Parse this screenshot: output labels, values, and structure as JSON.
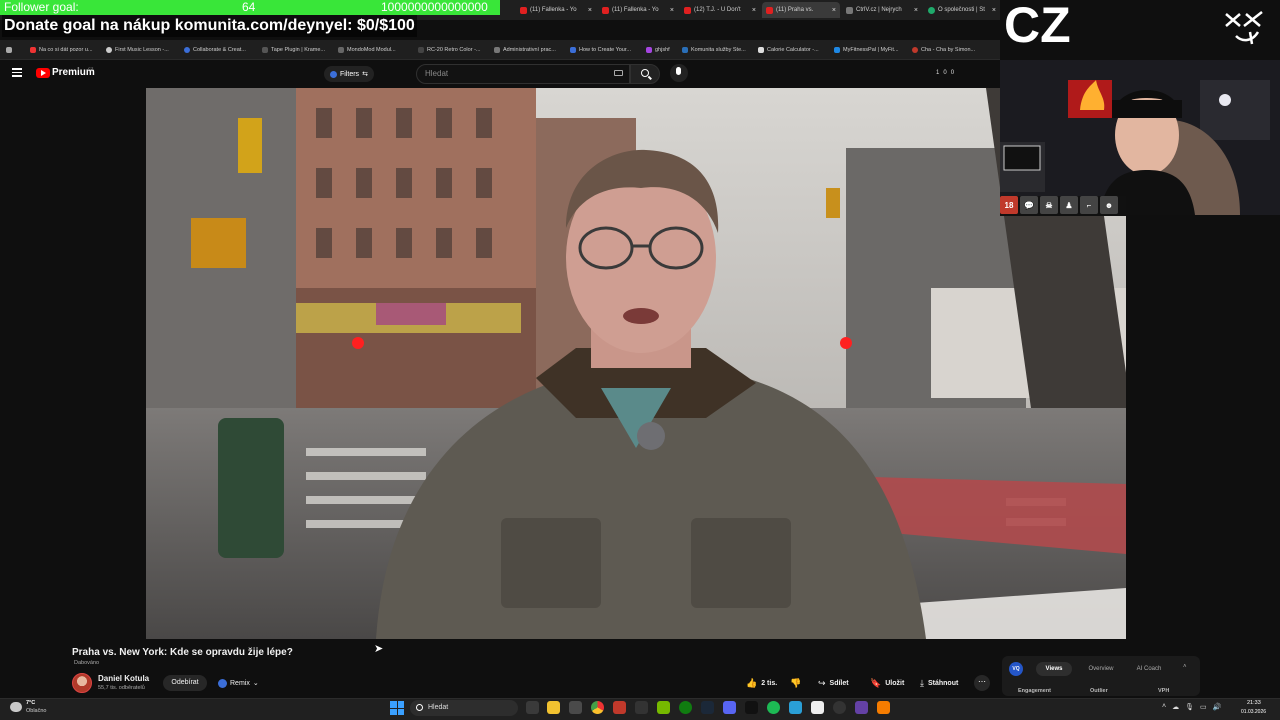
{
  "tabs": [
    {
      "title": "(11) Fallenka - Yo"
    },
    {
      "title": "(11) Fallenka - Yo"
    },
    {
      "title": "(12) T.J. - U Don't"
    },
    {
      "title": "(11) Praha vs."
    },
    {
      "title": "CtrlV.cz | Nejrych"
    },
    {
      "title": "O společnosti | St"
    }
  ],
  "overlay": {
    "goal_label": "Follower goal:",
    "goal_current": "64",
    "goal_target": "1000000000000000",
    "donate_text": "Donate goal na nákup komunita.com/deynyel: $0/$100",
    "cz_label": "CZ"
  },
  "bookmarks": [
    "Na co si dát pozor u...",
    "First Music Lesson -...",
    "Collaborate & Creat...",
    "Tape Plugin | Krame...",
    "MondoMod Modul...",
    "RC-20 Retro Color -...",
    "Administrativní prac...",
    "How to Create Your...",
    "ghjshf",
    "Komunita služby Ste...",
    "Calorie Calculator -...",
    "MyFitnessPal | MyFit...",
    "Cha - Cha by Simon..."
  ],
  "youtube": {
    "premium_label": "Premium",
    "region": "CZ",
    "filters_label": "Filters",
    "search_placeholder": "Hledat",
    "stats": [
      "1",
      "0",
      "0"
    ]
  },
  "video": {
    "title": "Praha vs. New York: Kde se opravdu žije lépe?",
    "badge": "Dabováno",
    "channel": "Daniel Kotula",
    "subscribers": "55,7 tis. odběratelů",
    "unsubscribe_label": "Odebírat",
    "remix_label": "Remix",
    "likes": "2 tis.",
    "share_label": "Sdílet",
    "save_label": "Uložit",
    "download_label": "Stáhnout"
  },
  "analytics": {
    "logo": "VQ",
    "tabs": [
      "Views",
      "Overview",
      "AI Coach"
    ],
    "active_tab": "Views",
    "columns": [
      "Engagement",
      "Outlier",
      "VPH"
    ]
  },
  "taskbar": {
    "temperature": "7°C",
    "weather": "Oblačno",
    "search_label": "Hledat",
    "time": "21:33",
    "date": "01.03.2026"
  },
  "colors": {
    "goal_bar": "#39e639",
    "youtube_red": "#ff0000",
    "accent_blue": "#3b6ed8"
  }
}
